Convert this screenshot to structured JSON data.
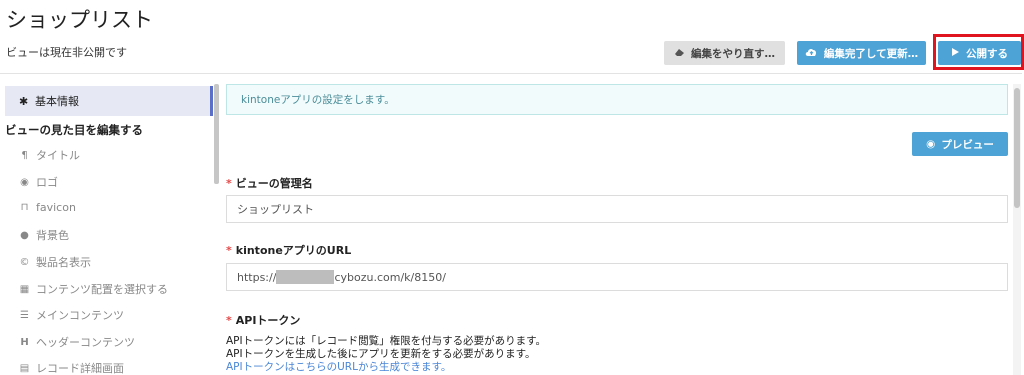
{
  "header": {
    "title": "ショップリスト",
    "status": "ビューは現在非公開です",
    "redo_label": "編集をやり直す…",
    "update_label": "編集完了して更新…",
    "publish_label": "公開する"
  },
  "sidebar": {
    "active_label": "基本情報",
    "group_label": "ビューの見た目を編集する",
    "items": [
      {
        "label": "タイトル",
        "icon": "paragraph-icon"
      },
      {
        "label": "ロゴ",
        "icon": "eye-icon"
      },
      {
        "label": "favicon",
        "icon": "bookmark-icon"
      },
      {
        "label": "背景色",
        "icon": "droplet-icon"
      },
      {
        "label": "製品名表示",
        "icon": "copyright-icon"
      },
      {
        "label": "コンテンツ配置を選択する",
        "icon": "grid-icon"
      },
      {
        "label": "メインコンテンツ",
        "icon": "list-icon"
      },
      {
        "label": "ヘッダーコンテンツ",
        "icon": "heading-icon"
      },
      {
        "label": "レコード詳細画面",
        "icon": "table-icon"
      }
    ]
  },
  "main": {
    "info_text": "kintoneアプリの設定をします。",
    "preview_label": "プレビュー",
    "view_name_label": "ビューの管理名",
    "view_name_value": "ショップリスト",
    "url_label": "kintoneアプリのURL",
    "url_prefix": "https://",
    "url_suffix": "cybozu.com/k/8150/",
    "token_label": "APIトークン",
    "token_desc_1": "APIトークンには「レコード閲覧」権限を付与する必要があります。",
    "token_desc_2": "APIトークンを生成した後にアプリを更新をする必要があります。",
    "token_link": "APIトークンはこちらのURLから生成できます。"
  },
  "colors": {
    "accent": "#4ea3d6",
    "highlight_border": "#e0141e",
    "required_star": "#e34b4b",
    "sidebar_active": "#e6e8f4"
  }
}
